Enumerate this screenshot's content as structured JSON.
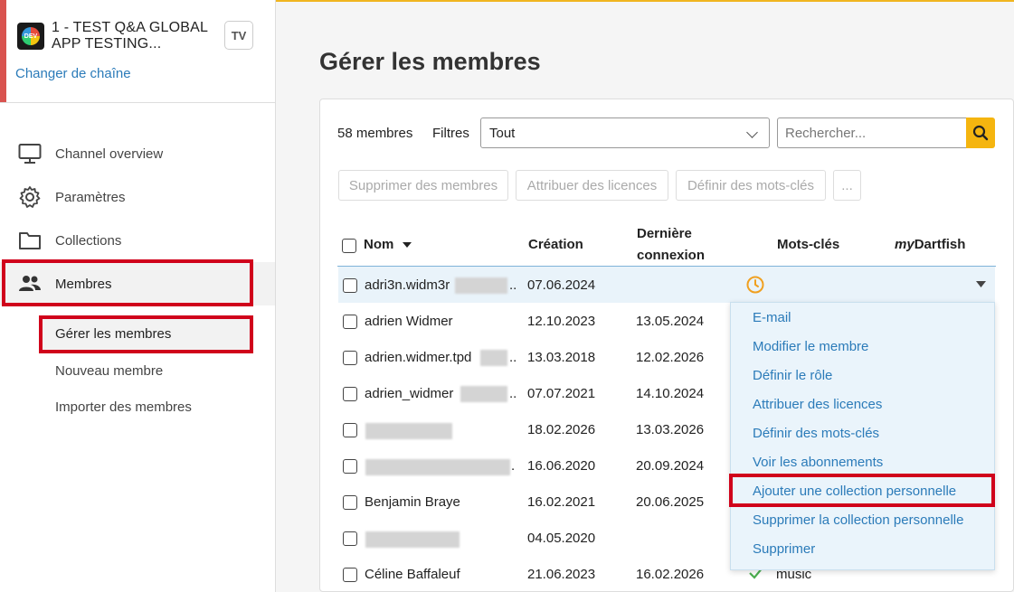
{
  "sidebar": {
    "channel_name": "1 - TEST Q&A GLOBAL APP TESTING...",
    "channel_badge": "TV",
    "change_channel": "Changer de chaîne",
    "nav": [
      {
        "label": "Channel overview",
        "icon": "monitor-icon"
      },
      {
        "label": "Paramètres",
        "icon": "gear-icon"
      },
      {
        "label": "Collections",
        "icon": "folder-icon"
      },
      {
        "label": "Membres",
        "icon": "users-icon"
      }
    ],
    "sub": {
      "manage": "Gérer les membres",
      "new": "Nouveau membre",
      "import": "Importer des membres"
    }
  },
  "main": {
    "title": "Gérer les membres",
    "count": "58  membres",
    "filters_label": "Filtres",
    "filter_value": "Tout",
    "search_placeholder": "Rechercher...",
    "actions": {
      "delete": "Supprimer des membres",
      "licenses": "Attribuer des licences",
      "keywords": "Définir des mots-clés",
      "more": "..."
    },
    "columns": {
      "name": "Nom",
      "created": "Création",
      "last_login_1": "Dernière",
      "last_login_2": "connexion",
      "keywords": "Mots-clés",
      "mydartfish_my": "my",
      "mydartfish_rest": "Dartfish"
    },
    "rows": [
      {
        "name": "adri3n.widm3r",
        "created": "07.06.2024",
        "last": ""
      },
      {
        "name": "adrien Widmer",
        "created": "12.10.2023",
        "last": "13.05.2024"
      },
      {
        "name": "adrien.widmer.tpd",
        "created": "13.03.2018",
        "last": "12.02.2026"
      },
      {
        "name": "adrien_widmer",
        "created": "07.07.2021",
        "last": "14.10.2024"
      },
      {
        "name": "",
        "created": "18.02.2026",
        "last": "13.03.2026"
      },
      {
        "name": "",
        "created": "16.06.2020",
        "last": "20.09.2024"
      },
      {
        "name": "Benjamin Braye",
        "created": "16.02.2021",
        "last": "20.06.2025"
      },
      {
        "name": "",
        "created": "04.05.2020",
        "last": ""
      },
      {
        "name": "Céline Baffaleuf",
        "created": "21.06.2023",
        "last": "16.02.2026",
        "keyword": "music"
      }
    ],
    "menu": [
      "E-mail",
      "Modifier le membre",
      "Définir le rôle",
      "Attribuer des licences",
      "Définir des mots-clés",
      "Voir les abonnements",
      "Ajouter une collection personnelle",
      "Supprimer la collection personnelle",
      "Supprimer"
    ]
  },
  "colors": {
    "accent": "#f5b50f",
    "link": "#2b7bb9",
    "highlight": "#d0021b",
    "status_pending": "#f0a020",
    "status_ok": "#4caf50"
  }
}
